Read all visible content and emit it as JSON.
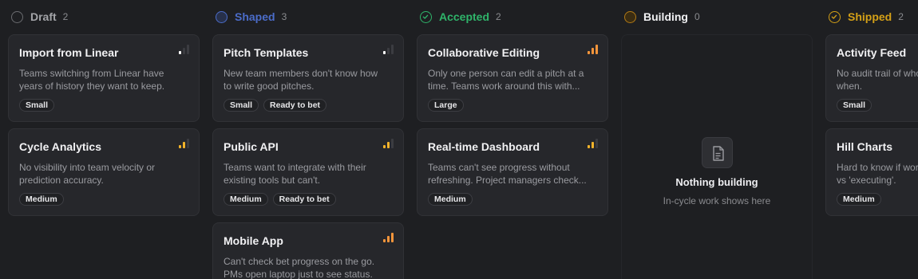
{
  "colors": {
    "draft": "#6b6c70",
    "shaped": "#4b6cc9",
    "accepted": "#2fb46a",
    "building": "#b27a16",
    "shipped": "#d4a017",
    "priority_high": "#f5953b",
    "priority_medium": "#f2b32a",
    "priority_low": "#ffffff",
    "bar_off": "#3b3c41"
  },
  "columns": [
    {
      "key": "draft",
      "title": "Draft",
      "count": "2",
      "icon": "circle-icon",
      "cards": [
        {
          "title": "Import from Linear",
          "desc": [
            "Teams switching from Linear have",
            "years of history they want to keep."
          ],
          "tags": [
            "Small"
          ],
          "priority": "low"
        },
        {
          "title": "Cycle Analytics",
          "desc": [
            "No visibility into team velocity or",
            "prediction accuracy."
          ],
          "tags": [
            "Medium"
          ],
          "priority": "medium"
        }
      ]
    },
    {
      "key": "shaped",
      "title": "Shaped",
      "count": "3",
      "icon": "circle-icon",
      "cards": [
        {
          "title": "Pitch Templates",
          "desc": [
            "New team members don't know how",
            "to write good pitches."
          ],
          "tags": [
            "Small",
            "Ready to bet"
          ],
          "priority": "low"
        },
        {
          "title": "Public API",
          "desc": [
            "Teams want to integrate with their",
            "existing tools but can't."
          ],
          "tags": [
            "Medium",
            "Ready to bet"
          ],
          "priority": "medium"
        },
        {
          "title": "Mobile App",
          "desc": [
            "Can't check bet progress on the go.",
            "PMs open laptop just to see status."
          ],
          "tags": [],
          "priority": "high"
        }
      ]
    },
    {
      "key": "accepted",
      "title": "Accepted",
      "count": "2",
      "icon": "check-circle-icon",
      "cards": [
        {
          "title": "Collaborative Editing",
          "desc": [
            "Only one person can edit a pitch at a",
            "time. Teams work around this with..."
          ],
          "tags": [
            "Large"
          ],
          "priority": "high"
        },
        {
          "title": "Real-time Dashboard",
          "desc": [
            "Teams can't see progress without",
            "refreshing. Project managers check..."
          ],
          "tags": [
            "Medium"
          ],
          "priority": "medium"
        }
      ]
    },
    {
      "key": "building",
      "title": "Building",
      "count": "0",
      "icon": "circle-icon",
      "cards": [],
      "empty": {
        "icon": "document-icon",
        "title": "Nothing building",
        "subtitle": "In-cycle work shows here"
      }
    },
    {
      "key": "shipped",
      "title": "Shipped",
      "count": "2",
      "icon": "check-circle-icon",
      "cards": [
        {
          "title": "Activity Feed",
          "desc": [
            "No audit trail of who changed what",
            "when."
          ],
          "tags": [
            "Small"
          ],
          "priority": ""
        },
        {
          "title": "Hill Charts",
          "desc": [
            "Hard to know if work is 'figuring out'",
            "vs 'executing'."
          ],
          "tags": [
            "Medium"
          ],
          "priority": ""
        }
      ]
    }
  ]
}
